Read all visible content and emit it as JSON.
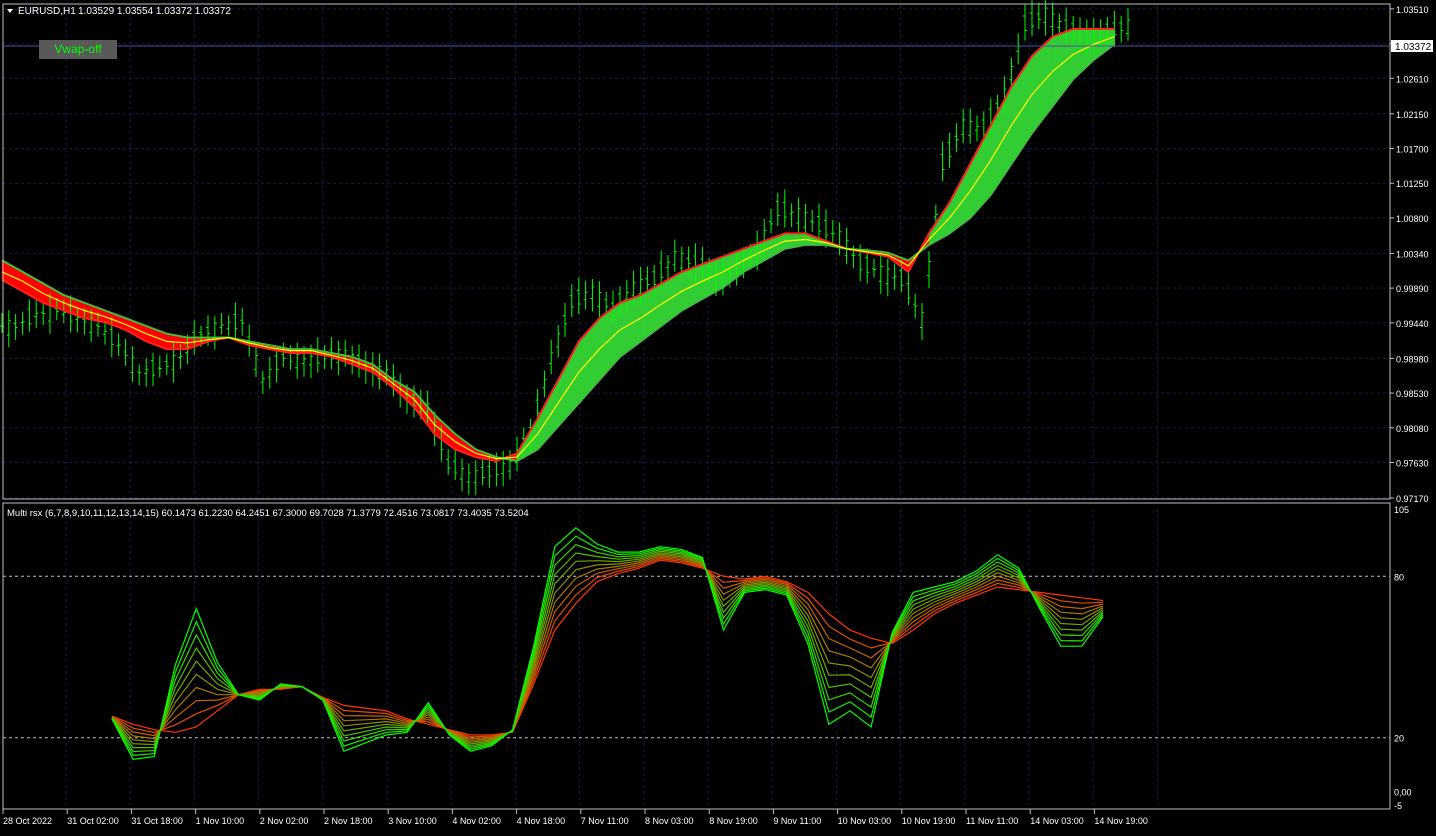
{
  "main_header": {
    "symbol": "EURUSD,H1",
    "ohlc": "1.03529 1.03554 1.03372 1.03372"
  },
  "vwap_button": {
    "label": "Vwap-off"
  },
  "sub_header": {
    "indicator": "Multi rsx (6,7,8,9,10,11,12,13,14,15) 60.1473 61.2230 64.2451 67.3000 69.7028 71.3779 72.4516 73.0817 73.4035 73.5204"
  },
  "price_label": "1.03372",
  "colors": {
    "background": "#000000",
    "grid": "#1a1a4a",
    "candle": "#00ff00",
    "bull_fill": "#32cd32",
    "bear_fill": "#ff0000",
    "midline": "#ffff00",
    "text": "#ffffff",
    "level": "#c0c0c0"
  },
  "chart_data": [
    {
      "type": "line",
      "title": "EURUSD,H1",
      "ylim": [
        0.9717,
        1.0356
      ],
      "y_ticks": [
        "1.03510",
        "1.03060",
        "1.02610",
        "1.02150",
        "1.01700",
        "1.01250",
        "1.00800",
        "1.00340",
        "0.99890",
        "0.99440",
        "0.98980",
        "0.98530",
        "0.98080",
        "0.97630",
        "0.97170"
      ],
      "x_ticks": [
        "28 Oct 2022",
        "31 Oct 02:00",
        "31 Oct 18:00",
        "1 Nov 10:00",
        "2 Nov 02:00",
        "2 Nov 18:00",
        "3 Nov 10:00",
        "4 Nov 02:00",
        "4 Nov 18:00",
        "7 Nov 11:00",
        "8 Nov 03:00",
        "8 Nov 19:00",
        "9 Nov 11:00",
        "10 Nov 03:00",
        "10 Nov 19:00",
        "11 Nov 11:00",
        "14 Nov 03:00",
        "14 Nov 19:00"
      ],
      "current_price": 1.03372,
      "series": [
        {
          "role": "close",
          "values": [
            0.994,
            0.9955,
            0.996,
            0.995,
            0.994,
            0.9915,
            0.988,
            0.9885,
            0.99,
            0.993,
            0.994,
            0.9945,
            0.987,
            0.99,
            0.9895,
            0.99,
            0.9905,
            0.9885,
            0.988,
            0.9845,
            0.9835,
            0.976,
            0.9745,
            0.975,
            0.976,
            0.98,
            0.99,
            0.997,
            0.9985,
            0.996,
            0.999,
            1.0,
            1.003,
            1.002,
            1.0005,
            1.001,
            1.004,
            1.009,
            1.0085,
            1.007,
            1.0055,
            1.002,
            1.001,
            1.0,
            0.995,
            1.015,
            1.02,
            1.0195,
            1.024,
            1.033,
            1.0345,
            1.0325,
            1.0315,
            1.032,
            1.033
          ]
        },
        {
          "role": "fast_ma",
          "values": [
            1.0,
            0.9985,
            0.997,
            0.996,
            0.995,
            0.9945,
            0.9935,
            0.992,
            0.991,
            0.991,
            0.992,
            0.9925,
            0.9915,
            0.991,
            0.9905,
            0.9905,
            0.99,
            0.989,
            0.988,
            0.986,
            0.9835,
            0.98,
            0.978,
            0.977,
            0.9765,
            0.9775,
            0.982,
            0.987,
            0.992,
            0.995,
            0.997,
            0.998,
            0.9995,
            1.001,
            1.002,
            1.003,
            1.004,
            1.005,
            1.006,
            1.006,
            1.005,
            1.004,
            1.0035,
            1.003,
            1.001,
            1.006,
            1.01,
            1.015,
            1.02,
            1.025,
            1.029,
            1.0315,
            1.0325,
            1.0325,
            1.0325
          ]
        },
        {
          "role": "slow_ma",
          "values": [
            1.0025,
            1.001,
            0.9995,
            0.998,
            0.997,
            0.996,
            0.995,
            0.994,
            0.993,
            0.9925,
            0.9925,
            0.9925,
            0.992,
            0.9915,
            0.991,
            0.991,
            0.9905,
            0.99,
            0.989,
            0.987,
            0.9855,
            0.9825,
            0.98,
            0.978,
            0.977,
            0.9765,
            0.978,
            0.981,
            0.984,
            0.987,
            0.99,
            0.992,
            0.994,
            0.996,
            0.9975,
            0.999,
            1.001,
            1.0025,
            1.004,
            1.0045,
            1.0045,
            1.004,
            1.0038,
            1.0035,
            1.0025,
            1.0045,
            1.006,
            1.008,
            1.011,
            1.015,
            1.019,
            1.0225,
            1.026,
            1.0285,
            1.0305
          ]
        },
        {
          "role": "mid_line",
          "values": [
            1.001,
            0.9998,
            0.9982,
            0.997,
            0.996,
            0.9952,
            0.9942,
            0.993,
            0.992,
            0.9918,
            0.9922,
            0.9925,
            0.9918,
            0.9912,
            0.9908,
            0.9908,
            0.9902,
            0.9895,
            0.9885,
            0.9865,
            0.9845,
            0.9812,
            0.979,
            0.9775,
            0.9768,
            0.977,
            0.98,
            0.984,
            0.988,
            0.991,
            0.9935,
            0.995,
            0.9968,
            0.9985,
            0.9998,
            1.001,
            1.0025,
            1.0038,
            1.005,
            1.0052,
            1.0048,
            1.004,
            1.0036,
            1.0032,
            1.0018,
            1.0052,
            1.008,
            1.0115,
            1.0155,
            1.02,
            1.024,
            1.027,
            1.0292,
            1.0305,
            1.0315
          ]
        }
      ]
    },
    {
      "type": "line",
      "title": "Multi rsx (6,7,8,9,10,11,12,13,14,15)",
      "ylim": [
        -5,
        105
      ],
      "y_ticks": [
        "105",
        "80",
        "20",
        "0,00",
        "-5"
      ],
      "levels": [
        80,
        20
      ],
      "x_range": [
        4,
        54
      ],
      "series": [
        {
          "name": "6",
          "values": [
            27,
            12,
            13,
            47,
            68,
            48,
            36,
            34,
            40,
            39,
            34,
            15,
            18,
            21,
            22,
            33,
            21,
            15,
            17,
            23,
            54,
            91,
            98,
            92,
            89,
            89,
            91,
            90,
            87,
            60,
            74,
            75,
            73,
            55,
            25,
            30,
            24,
            59,
            74,
            76,
            78,
            82,
            88,
            83,
            68,
            54,
            54,
            65
          ]
        },
        {
          "name": "15",
          "values": [
            28,
            25,
            23,
            22,
            24,
            30,
            36,
            38,
            38,
            39,
            35,
            32,
            31,
            30,
            27,
            25,
            23,
            21,
            21,
            22,
            40,
            60,
            70,
            78,
            81,
            83,
            86,
            85,
            83,
            80,
            79,
            80,
            78,
            74,
            66,
            60,
            57,
            55,
            60,
            66,
            70,
            73,
            76,
            75,
            74,
            73,
            72,
            71
          ]
        }
      ],
      "last_values": [
        60.1473,
        61.223,
        64.2451,
        67.3,
        69.7028,
        71.3779,
        72.4516,
        73.0817,
        73.4035,
        73.5204
      ]
    }
  ]
}
